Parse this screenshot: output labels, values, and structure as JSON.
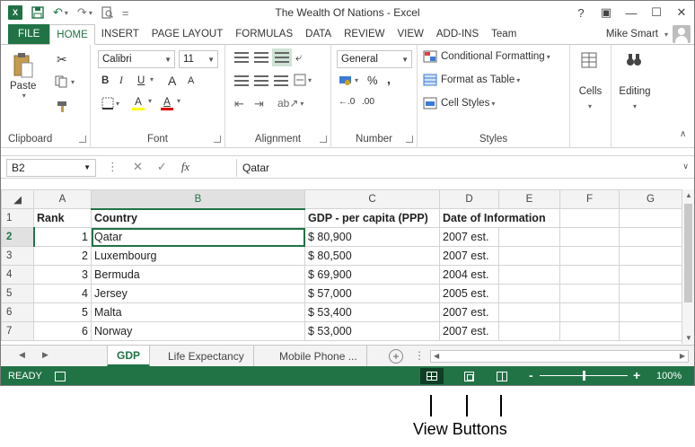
{
  "window": {
    "title": "The Wealth Of Nations - Excel",
    "logo_text": "X",
    "controls": [
      "?",
      "▣",
      "—",
      "☐",
      "✕"
    ]
  },
  "tabs": [
    {
      "label": "FILE"
    },
    {
      "label": "HOME"
    },
    {
      "label": "INSERT"
    },
    {
      "label": "PAGE LAYOUT"
    },
    {
      "label": "FORMULAS"
    },
    {
      "label": "DATA"
    },
    {
      "label": "REVIEW"
    },
    {
      "label": "VIEW"
    },
    {
      "label": "ADD-INS"
    },
    {
      "label": "Team"
    }
  ],
  "active_tab": "HOME",
  "user": {
    "name": "Mike Smart"
  },
  "ribbon": {
    "clipboard": {
      "label": "Clipboard",
      "paste": "Paste"
    },
    "font": {
      "label": "Font",
      "name": "Calibri",
      "size": "11",
      "bold": "B",
      "italic": "I",
      "underline": "U",
      "grow": "A",
      "shrink": "A",
      "fill": "A",
      "color": "A"
    },
    "alignment": {
      "label": "Alignment"
    },
    "number": {
      "label": "Number",
      "format": "General",
      "percent": "%",
      "comma": ",",
      "inc_dec": "←.0",
      "dec_dec": ".00"
    },
    "styles": {
      "label": "Styles",
      "conditional": "Conditional Formatting",
      "table": "Format as Table",
      "cell_styles": "Cell Styles"
    },
    "cells": {
      "label": "Cells"
    },
    "editing": {
      "label": "Editing"
    }
  },
  "formula_bar": {
    "name_box": "B2",
    "cancel": "✕",
    "enter": "✓",
    "fx": "fx",
    "value": "Qatar"
  },
  "sheet": {
    "columns": [
      "A",
      "B",
      "C",
      "D",
      "E",
      "F",
      "G"
    ],
    "selected_column": "B",
    "selected_row": "2",
    "rows": [
      {
        "row": "1",
        "cells": [
          "Rank",
          "Country",
          "GDP - per capita (PPP)",
          "Date of Information",
          "",
          "",
          ""
        ]
      },
      {
        "row": "2",
        "cells": [
          "1",
          "Qatar",
          "$ 80,900",
          "2007 est.",
          "",
          "",
          ""
        ]
      },
      {
        "row": "3",
        "cells": [
          "2",
          "Luxembourg",
          "$ 80,500",
          "2007 est.",
          "",
          "",
          ""
        ]
      },
      {
        "row": "4",
        "cells": [
          "3",
          "Bermuda",
          "$ 69,900",
          "2004 est.",
          "",
          "",
          ""
        ]
      },
      {
        "row": "5",
        "cells": [
          "4",
          "Jersey",
          "$ 57,000",
          "2005 est.",
          "",
          "",
          ""
        ]
      },
      {
        "row": "6",
        "cells": [
          "5",
          "Malta",
          "$ 53,400",
          "2007 est.",
          "",
          "",
          ""
        ]
      },
      {
        "row": "7",
        "cells": [
          "6",
          "Norway",
          "$ 53,000",
          "2007 est.",
          "",
          "",
          ""
        ]
      }
    ]
  },
  "sheet_tabs": [
    {
      "label": "GDP"
    },
    {
      "label": "Life Expectancy"
    },
    {
      "label": "Mobile Phone ..."
    }
  ],
  "add_sheet": "+",
  "status": {
    "ready": "READY",
    "zoom_minus": "-",
    "zoom_plus": "+",
    "zoom": "100%",
    "zoom_level": 1.0
  },
  "annotation": {
    "caption": "View Buttons"
  },
  "colors": {
    "accent": "#217346",
    "status_bar": "#217346"
  }
}
